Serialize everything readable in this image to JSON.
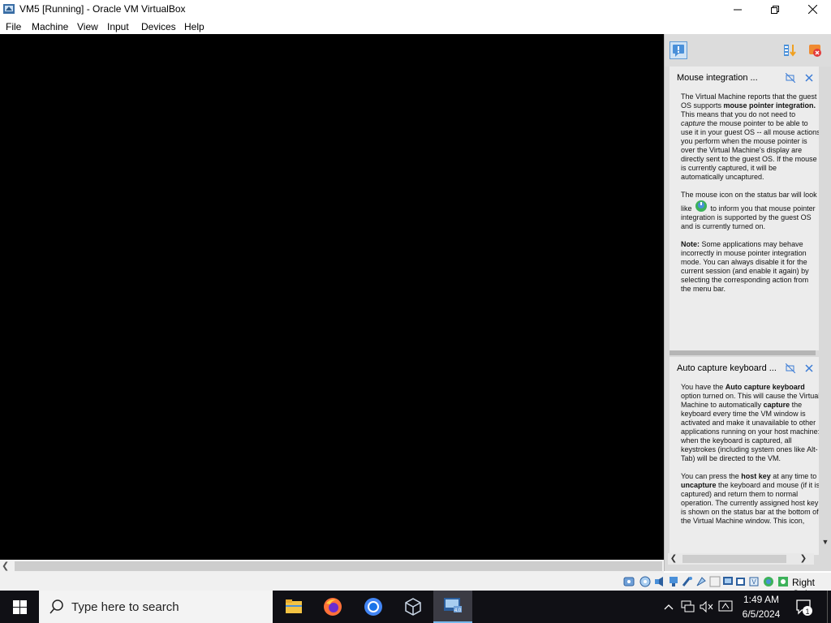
{
  "window": {
    "title": "VM5 [Running] - Oracle VM VirtualBox",
    "controls": [
      "minimize",
      "maximize",
      "close"
    ]
  },
  "menu": {
    "items": [
      "File",
      "Machine",
      "View",
      "Input",
      "Devices",
      "Help"
    ]
  },
  "notifications": [
    {
      "title": "Mouse integration ...",
      "paragraphs": [
        {
          "runs": [
            {
              "t": "The Virtual Machine reports that the guest OS supports "
            },
            {
              "t": "mouse pointer integration.",
              "b": true
            },
            {
              "t": " This means that you do not need to "
            },
            {
              "t": "capture",
              "i": true
            },
            {
              "t": " the mouse pointer to be able to use it in your guest OS -- all mouse actions you perform when the mouse pointer is over the Virtual Machine's display are directly sent to the guest OS. If the mouse is currently captured, it will be automatically uncaptured."
            }
          ]
        },
        {
          "runs": [
            {
              "t": "The mouse icon on the status bar will look like "
            },
            {
              "icon": "mouse-integration-icon"
            },
            {
              "t": " to inform you that mouse pointer integration is supported by the guest OS and is currently turned on."
            }
          ]
        },
        {
          "runs": [
            {
              "t": "Note:",
              "b": true
            },
            {
              "t": " Some applications may behave incorrectly in mouse pointer integration mode. You can always disable it for the current session (and enable it again) by selecting the corresponding action from the menu bar."
            }
          ]
        }
      ]
    },
    {
      "title": "Auto capture keyboard ...",
      "paragraphs": [
        {
          "runs": [
            {
              "t": "You have the "
            },
            {
              "t": "Auto capture keyboard",
              "b": true
            },
            {
              "t": " option turned on. This will cause the Virtual Machine to automatically "
            },
            {
              "t": "capture",
              "b": true
            },
            {
              "t": " the keyboard every time the VM window is activated and make it unavailable to other applications running on your host machine: when the keyboard is captured, all keystrokes (including system ones like Alt-Tab) will be directed to the VM."
            }
          ]
        },
        {
          "runs": [
            {
              "t": "You can press the "
            },
            {
              "t": "host key",
              "b": true
            },
            {
              "t": " at any time to "
            },
            {
              "t": "uncapture",
              "b": true
            },
            {
              "t": " the keyboard and mouse (if it is captured) and return them to normal operation. The currently assigned host key is shown on the status bar at the bottom of the Virtual Machine window. This icon,"
            }
          ]
        }
      ]
    }
  ],
  "statusbar": {
    "icons": [
      "hard-disk-icon",
      "optical-disk-icon",
      "audio-icon",
      "network-icon",
      "usb-icon",
      "shared-folder-icon",
      "display-icon",
      "video-capture-icon",
      "recording-icon",
      "cpu-icon",
      "mouse-integration-icon",
      "keyboard-capture-icon"
    ],
    "host_key": "Right Ctrl"
  },
  "taskbar": {
    "search_placeholder": "Type here to search",
    "apps": [
      "file-explorer-icon",
      "firefox-icon",
      "chrome-icon",
      "virtualbox-icon",
      "vm-icon"
    ],
    "time": "1:49 AM",
    "date": "6/5/2024",
    "notification_count": "1"
  },
  "colors": {
    "vm_display": "#000000",
    "taskbar": "#101015",
    "panel": "#d9d9d9",
    "notification": "#ececec"
  }
}
